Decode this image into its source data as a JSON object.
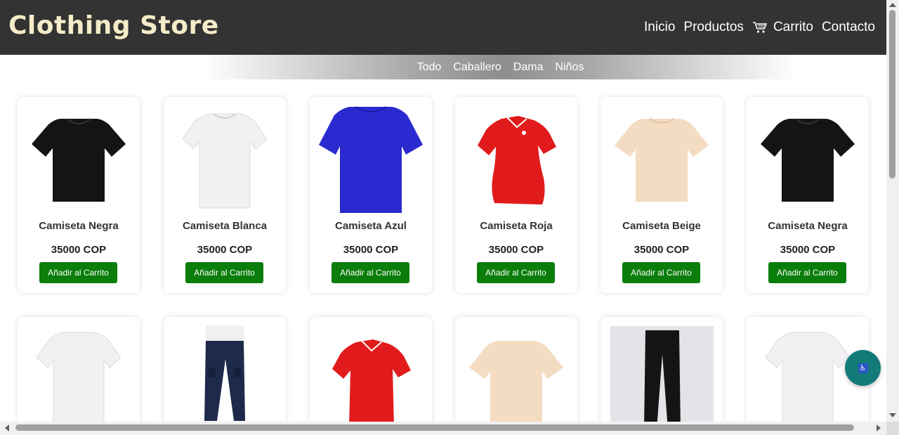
{
  "header": {
    "brand": "Clothing Store",
    "nav": {
      "inicio": "Inicio",
      "productos": "Productos",
      "carrito": "Carrito",
      "contacto": "Contacto"
    }
  },
  "subnav": {
    "todo": "Todo",
    "caballero": "Caballero",
    "dama": "Dama",
    "ninos": "Niños"
  },
  "products": [
    {
      "name": "Camiseta Negra",
      "price": "35000 COP",
      "button": "Añadir al Carrito",
      "image_icon": "black-tshirt-icon"
    },
    {
      "name": "Camiseta Blanca",
      "price": "35000 COP",
      "button": "Añadir al Carrito",
      "image_icon": "white-tshirt-icon"
    },
    {
      "name": "Camiseta Azul",
      "price": "35000 COP",
      "button": "Añadir al Carrito",
      "image_icon": "blue-tshirt-icon"
    },
    {
      "name": "Camiseta Roja",
      "price": "35000 COP",
      "button": "Añadir al Carrito",
      "image_icon": "red-polo-icon"
    },
    {
      "name": "Camiseta Beige",
      "price": "35000 COP",
      "button": "Añadir al Carrito",
      "image_icon": "beige-tshirt-icon"
    },
    {
      "name": "Camiseta Negra",
      "price": "35000 COP",
      "button": "Añadir al Carrito",
      "image_icon": "black-tshirt-icon"
    }
  ],
  "second_row_icons": [
    "white-tshirt-icon",
    "cargo-pants-icon",
    "red-polo-icon",
    "beige-tshirt-icon",
    "black-jeans-icon",
    "white-tshirt-icon"
  ],
  "colors": {
    "header_bg": "#333333",
    "brand": "#f4ecc8",
    "button_bg": "#0a7d0a",
    "a11y_bg": "#137a7a"
  }
}
